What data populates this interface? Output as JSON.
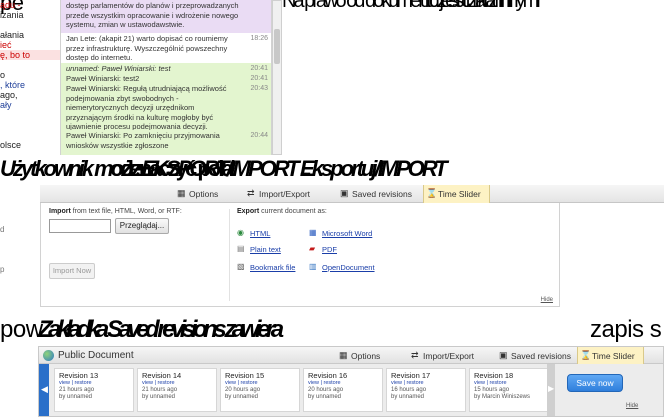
{
  "captions": {
    "line1": [
      "pe",
      "Na prawo od dokumentu jest czat z innymi",
      "uczestnikami"
    ],
    "line2": [
      "Użytkownik może EKSPORT/IMPORT ...",
      "odznaczyć pola",
      "Eksportuj/IMPORT"
    ],
    "line3_plain": "pow",
    "line3_bold": "Zakładka Saved revisions zawiera",
    "line3_tail": "zapis s"
  },
  "chat_left": [
    {
      "t": "ądu -",
      "cls": "red"
    },
    {
      "t": "izania",
      "cls": ""
    },
    {
      "t": "",
      "cls": ""
    },
    {
      "t": "ałania",
      "cls": ""
    },
    {
      "t": "ieć",
      "cls": "red"
    },
    {
      "t": "ę, bo to",
      "cls": "red hl"
    },
    {
      "t": "",
      "cls": ""
    },
    {
      "t": "o",
      "cls": ""
    },
    {
      "t": ", które",
      "cls": "blue"
    },
    {
      "t": "ago,",
      "cls": ""
    },
    {
      "t": "ały",
      "cls": "blue"
    },
    {
      "t": "",
      "cls": ""
    },
    {
      "t": "",
      "cls": ""
    },
    {
      "t": "",
      "cls": ""
    },
    {
      "t": "olsce",
      "cls": ""
    }
  ],
  "chat": {
    "messages": [
      {
        "text": "dostęp parlamentów do planów i przeprowadzanych przede wszystkim opracowanie i wdrożenie nowego systemu, zmian w ustawodawstwie.",
        "time": "",
        "bg": "#eadcf4"
      },
      {
        "text": "Jan Lete: (akapit 21) warto dopisać co roumiemy przez infrastrukturę. Wyszczególnić powszechny dostęp do internetu.",
        "time": "18:26",
        "bg": "#ffffff"
      },
      {
        "text": "unnamed: Paweł Winiarski: test",
        "time": "20:41",
        "bg": "#e3f5cf",
        "italic": true
      },
      {
        "text": "Paweł Winiarski: test2",
        "time": "20:41",
        "bg": "#e3f5cf"
      },
      {
        "text": "Paweł Winiarski: Regułą utrudniającą możliwość podejmowania zbyt swobodnych - niemerytorycznych decyzji urzędnikom przyznającym środki na kulturę mogłoby być ujawnienie procesu podejmowania decyzji.",
        "time": "20:43",
        "bg": "#e3f5cf"
      },
      {
        "text": "Paweł Winiarski: Po zamknięciu przyjmowania wniosków wszystkie zgłoszone",
        "time": "20:44",
        "bg": "#e3f5cf"
      }
    ]
  },
  "toolbar": {
    "options": "Options",
    "import_export": "Import/Export",
    "saved_revisions": "Saved revisions",
    "time_slider": "Time Slider"
  },
  "import_panel": {
    "import_label": "Import",
    "import_desc": "from text file, HTML, Word, or RTF:",
    "browse": "Przeglądaj...",
    "import_now": "Import Now",
    "export_label": "Export",
    "export_desc": "current document as:",
    "exports": [
      "HTML",
      "Microsoft Word",
      "Plain text",
      "PDF",
      "Bookmark file",
      "OpenDocument"
    ],
    "hide": "Hide"
  },
  "left_frag2": [
    "d",
    "",
    "",
    "",
    "p"
  ],
  "revisions_panel": {
    "doc_title": "Public Document",
    "options": "Options",
    "import_export": "Import/Export",
    "saved_revisions": "Saved revisions",
    "time_slider": "Time Slider",
    "revisions": [
      {
        "title": "Revision 13",
        "links": "view | restore",
        "ago": "21 hours ago",
        "by": "by unnamed"
      },
      {
        "title": "Revision 14",
        "links": "view | restore",
        "ago": "21 hours ago",
        "by": "by unnamed"
      },
      {
        "title": "Revision 15",
        "links": "view | restore",
        "ago": "20 hours ago",
        "by": "by unnamed"
      },
      {
        "title": "Revision 16",
        "links": "view | restore",
        "ago": "20 hours ago",
        "by": "by unnamed"
      },
      {
        "title": "Revision 17",
        "links": "view | restore",
        "ago": "16 hours ago",
        "by": "by unnamed"
      },
      {
        "title": "Revision 18",
        "links": "view | restore",
        "ago": "15 hours ago",
        "by": "by Marcin Winiszews"
      }
    ],
    "save_now": "Save now",
    "hide": "Hide"
  },
  "icons": {
    "options": "document-icon",
    "import_export": "swap-arrows-icon",
    "saved_revisions": "floppy-disk-icon",
    "time_slider": "hourglass-icon"
  },
  "colors": {
    "accent_blue": "#2f7fdc",
    "slider_bg": "#fdf2c4"
  }
}
